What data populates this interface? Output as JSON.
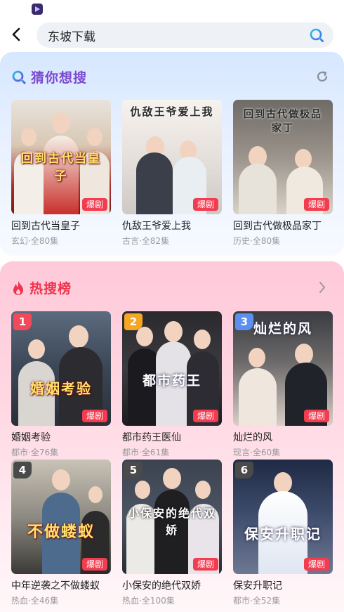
{
  "search": {
    "value": "东坡下载"
  },
  "guess": {
    "title": "猜你想搜",
    "items": [
      {
        "title": "回到古代当皇子",
        "meta": "玄幻·全80集",
        "badge": "爆剧",
        "poster_text": "回到古代当皇子"
      },
      {
        "title": "仇敌王爷爱上我",
        "meta": "古言·全82集",
        "badge": "爆剧",
        "poster_text": "仇敌王爷爱上我"
      },
      {
        "title": "回到古代做极品家丁",
        "meta": "历史·全80集",
        "badge": "爆剧",
        "poster_text": "回到古代做极品家丁"
      }
    ]
  },
  "hot": {
    "title": "热搜榜",
    "items": [
      {
        "rank": "1",
        "title": "婚姻考验",
        "meta": "都市·全76集",
        "badge": "爆剧",
        "poster_text": "婚姻考验"
      },
      {
        "rank": "2",
        "title": "都市药王医仙",
        "meta": "都市·全61集",
        "badge": "爆剧",
        "poster_text": "都市药王"
      },
      {
        "rank": "3",
        "title": "灿烂的风",
        "meta": "现言·全60集",
        "badge": "爆剧",
        "poster_text": "灿烂的风"
      },
      {
        "rank": "4",
        "title": "中年逆袭之不做蝼蚁",
        "meta": "热血·全46集",
        "badge": "爆剧",
        "poster_text": "不做蝼蚁"
      },
      {
        "rank": "5",
        "title": "小保安的绝代双娇",
        "meta": "热血·全100集",
        "badge": "爆剧",
        "poster_text": "小保安的绝代双娇"
      },
      {
        "rank": "6",
        "title": "保安升职记",
        "meta": "都市·全52集",
        "badge": "爆剧",
        "poster_text": "保安升职记"
      }
    ]
  },
  "colors": {
    "accent_guess": "#7b4ad0",
    "accent_hot": "#f0334d",
    "badge": "#f23c50",
    "rank_1": "#f24a5a",
    "rank_2": "#f5a623",
    "rank_3": "#5b8ff0",
    "rank_other": "#4a4a4a"
  }
}
